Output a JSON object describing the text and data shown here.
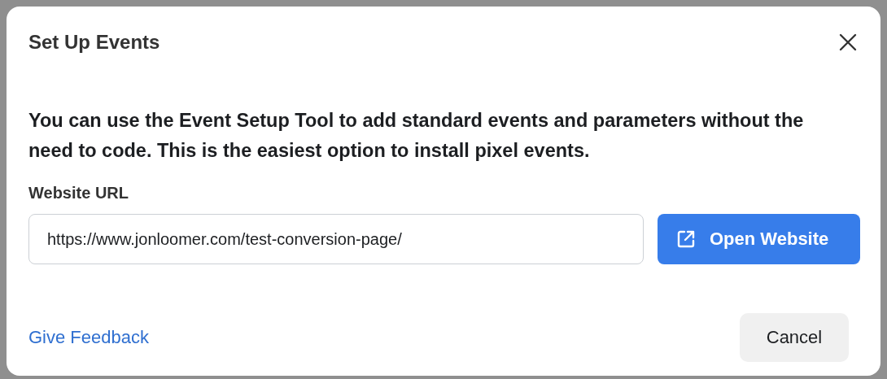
{
  "dialog": {
    "title": "Set Up Events",
    "description": "You can use the Event Setup Tool to add standard events and parameters without the need to code. This is the easiest option to install pixel events.",
    "url_field": {
      "label": "Website URL",
      "value": "https://www.jonloomer.com/test-conversion-page/"
    },
    "open_button": "Open Website",
    "feedback_link": "Give Feedback",
    "cancel_button": "Cancel"
  }
}
